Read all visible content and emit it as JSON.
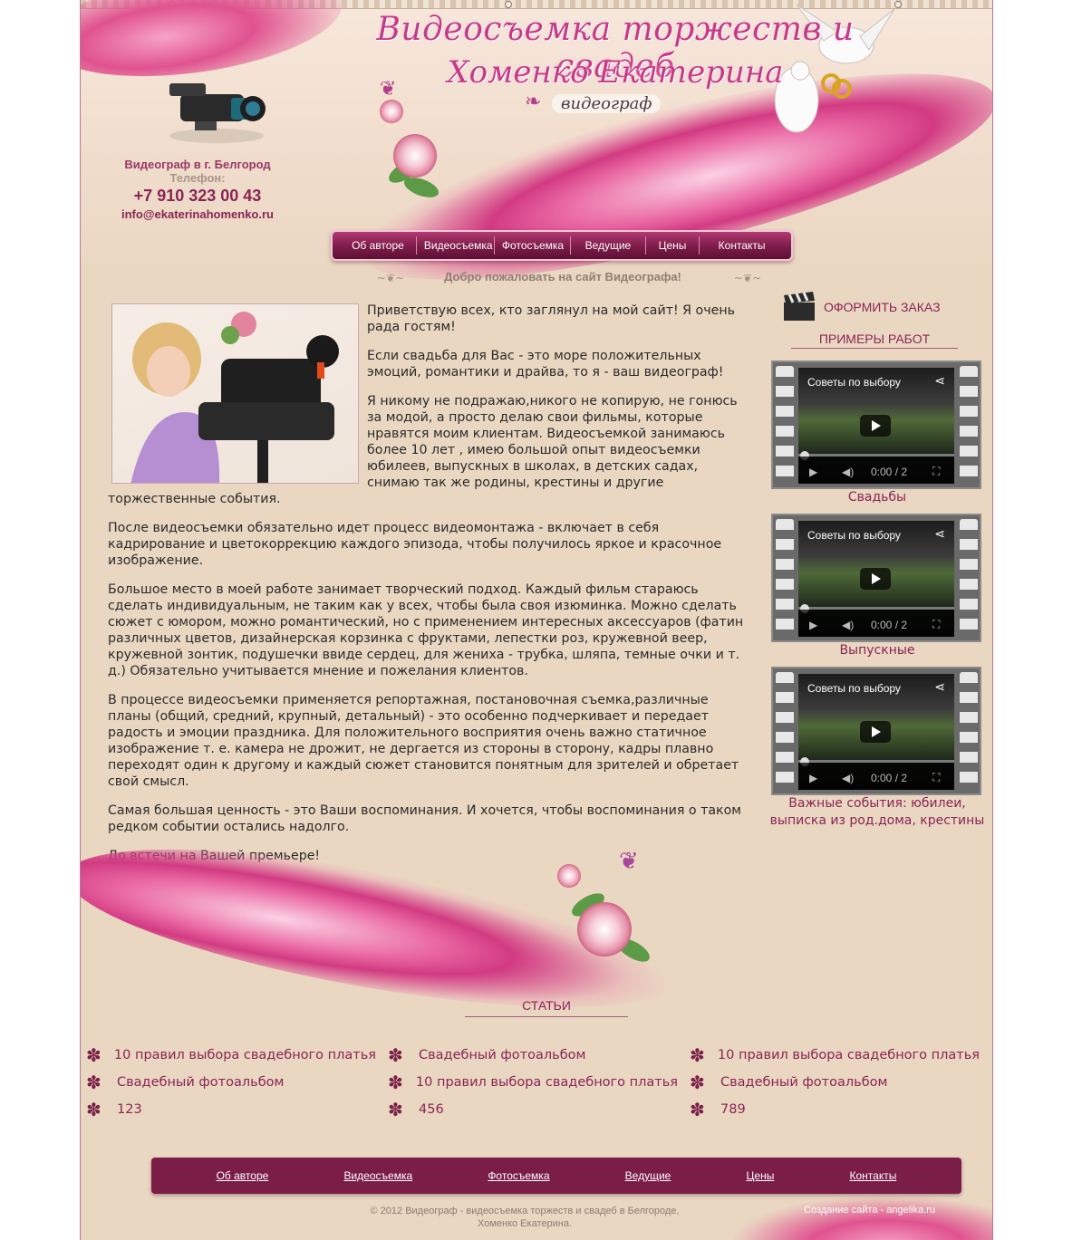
{
  "header": {
    "title_line1": "Видеосъемка торжеств и свадеб",
    "title_line2": "Хоменко Екатерина",
    "subtitle": "видеограф"
  },
  "contact": {
    "city": "Видеограф в г. Белгород",
    "phone_label": "Телефон:",
    "phone": "+7 910 323 00 43",
    "email": "info@ekaterinahomenko.ru"
  },
  "nav": {
    "items": [
      "Об авторе",
      "Видеосъемка",
      "Фотосъемка",
      "Ведущие",
      "Цены",
      "Контакты"
    ]
  },
  "welcome": "Добро пожаловать на сайт Видеографа!",
  "main": {
    "paragraphs": [
      "Приветствую всех, кто заглянул на мой сайт! Я очень рада гостям!",
      "Если свадьба для Вас - это море положительных эмоций, романтики и драйва, то я - ваш видеограф!",
      "Я никому не подражаю,никого не копирую, не гонюсь за модой, а просто делаю свои фильмы, которые нравятся моим клиентам. Видеосъемкой занимаюсь более 10 лет , имею большой опыт видеосъемки юбилеев, выпускных в школах, в детских садах, снимаю так же родины, крестины и другие торжественные события.",
      "После видеосъемки обязательно идет процесс видеомонтажа - включает в себя кадрирование и цветокоррекцию каждого эпизода, чтобы получилось яркое и красочное изображение.",
      "Большое место в моей работе занимает творческий подход. Каждый фильм стараюсь сделать индивидуальным, не таким как у всех, чтобы была своя изюминка. Можно сделать сюжет с юмором, можно романтический, но с применением интересных аксессуаров (фатин различных цветов, дизайнерская корзинка с фруктами, лепестки роз, кружевной веер, кружевной зонтик, подушечки ввиде сердец, для жениха - трубка, шляпа, темные очки и т. д.) Обязательно учитывается мнение и пожелания клиентов.",
      "В процессе видеосъемки применяется репортажная, постановочная съемка,различные планы (общий, средний, крупный, детальный) - это особенно подчеркивает и передает радость и эмоции праздника. Для положительного восприятия очень важно статичное изображение т. е. камера не дрожит, не дергается из стороны в сторону, кадры плавно переходят один к другому и каждый сюжет становится понятным для зрителей и обретает свой смысл.",
      "Самая большая ценность - это Ваши воспоминания. И хочется, чтобы воспоминания о таком редком событии остались надолго.",
      "До встечи на Вашей премьере!"
    ]
  },
  "sidebar": {
    "order_label": "ОФОРМИТЬ ЗАКАЗ",
    "examples_title": "ПРИМЕРЫ РАБОТ",
    "videos": [
      {
        "title": "Советы по выбору",
        "time": "0:00 / 2",
        "caption": "Свадьбы"
      },
      {
        "title": "Советы по выбору",
        "time": "0:00 / 2",
        "caption": "Выпускные"
      },
      {
        "title": "Советы по выбору",
        "time": "0:00 / 2",
        "caption": "Важные события: юбилеи, выписка из род.дома, крестины"
      }
    ]
  },
  "articles": {
    "title": "СТАТЬИ",
    "columns": [
      [
        "10 правил выбора свадебного платья",
        "Свадебный фотоальбом",
        "123"
      ],
      [
        "Свадебный фотоальбом",
        "10 правил выбора свадебного платья",
        "456"
      ],
      [
        "10 правил выбора свадебного платья",
        "Свадебный фотоальбом",
        "789"
      ]
    ]
  },
  "footer": {
    "nav": [
      "Об авторе",
      "Видеосъемка",
      "Фотосъемка",
      "Ведущие",
      "Цены",
      "Контакты"
    ],
    "copyright_line1": "© 2012 Видеограф - видеосъемка торжеств и свадеб в Белгороде,",
    "copyright_line2": "Хоменко Екатерина.",
    "credits": "Создание сайта - angelika.ru"
  },
  "colors": {
    "background": "#ead7c2",
    "accent": "#8a2455",
    "nav": "#7a1d47",
    "silk": "#e0528f"
  }
}
